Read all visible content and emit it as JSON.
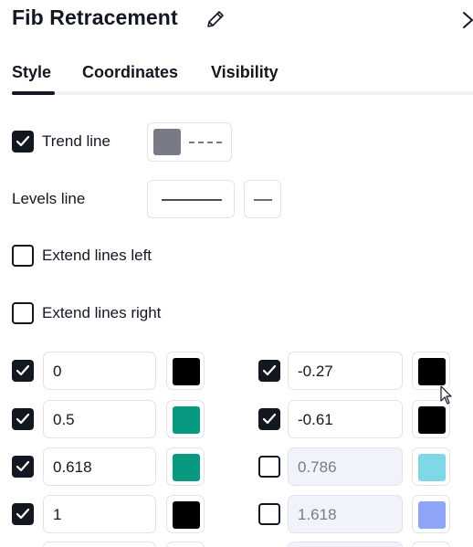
{
  "header": {
    "title": "Fib Retracement",
    "edit_icon": "pencil-icon",
    "close_icon": "chevron-right-icon"
  },
  "tabs": [
    {
      "label": "Style",
      "active": true
    },
    {
      "label": "Coordinates",
      "active": false
    },
    {
      "label": "Visibility",
      "active": false
    }
  ],
  "options": {
    "trend_line": {
      "label": "Trend line",
      "checked": true,
      "color": "#787b86",
      "style": "dashed"
    },
    "levels_line": {
      "label": "Levels line"
    },
    "extend_left": {
      "label": "Extend lines left",
      "checked": false
    },
    "extend_right": {
      "label": "Extend lines right",
      "checked": false
    }
  },
  "levels_left": [
    {
      "value": "0",
      "checked": true,
      "color": "#000000"
    },
    {
      "value": "0.5",
      "checked": true,
      "color": "#089981"
    },
    {
      "value": "0.618",
      "checked": true,
      "color": "#089981"
    },
    {
      "value": "1",
      "checked": true,
      "color": "#000000"
    }
  ],
  "levels_right": [
    {
      "value": "-0.27",
      "checked": true,
      "color": "#000000"
    },
    {
      "value": "-0.61",
      "checked": true,
      "color": "#000000"
    },
    {
      "value": "0.786",
      "checked": false,
      "color": "#80d8e6"
    },
    {
      "value": "1.618",
      "checked": false,
      "color": "#8fa5f7"
    }
  ]
}
